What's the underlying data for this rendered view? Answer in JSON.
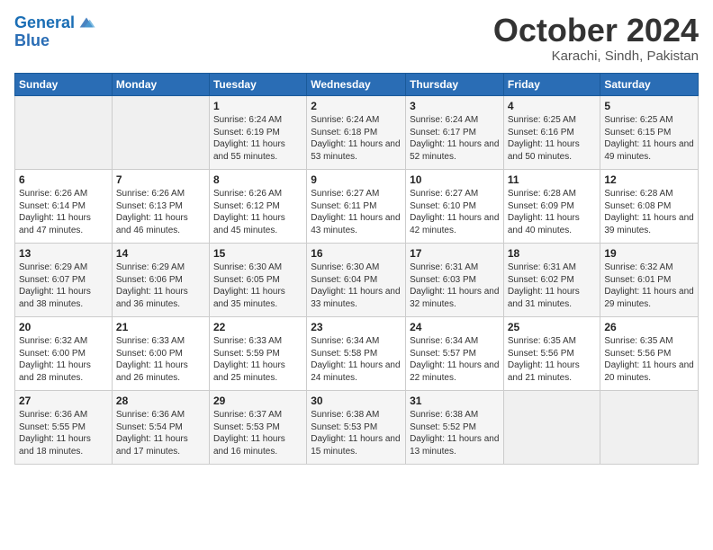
{
  "header": {
    "logo_line1": "General",
    "logo_line2": "Blue",
    "month": "October 2024",
    "location": "Karachi, Sindh, Pakistan"
  },
  "days_of_week": [
    "Sunday",
    "Monday",
    "Tuesday",
    "Wednesday",
    "Thursday",
    "Friday",
    "Saturday"
  ],
  "weeks": [
    [
      {
        "day": "",
        "info": ""
      },
      {
        "day": "",
        "info": ""
      },
      {
        "day": "1",
        "info": "Sunrise: 6:24 AM\nSunset: 6:19 PM\nDaylight: 11 hours and 55 minutes."
      },
      {
        "day": "2",
        "info": "Sunrise: 6:24 AM\nSunset: 6:18 PM\nDaylight: 11 hours and 53 minutes."
      },
      {
        "day": "3",
        "info": "Sunrise: 6:24 AM\nSunset: 6:17 PM\nDaylight: 11 hours and 52 minutes."
      },
      {
        "day": "4",
        "info": "Sunrise: 6:25 AM\nSunset: 6:16 PM\nDaylight: 11 hours and 50 minutes."
      },
      {
        "day": "5",
        "info": "Sunrise: 6:25 AM\nSunset: 6:15 PM\nDaylight: 11 hours and 49 minutes."
      }
    ],
    [
      {
        "day": "6",
        "info": "Sunrise: 6:26 AM\nSunset: 6:14 PM\nDaylight: 11 hours and 47 minutes."
      },
      {
        "day": "7",
        "info": "Sunrise: 6:26 AM\nSunset: 6:13 PM\nDaylight: 11 hours and 46 minutes."
      },
      {
        "day": "8",
        "info": "Sunrise: 6:26 AM\nSunset: 6:12 PM\nDaylight: 11 hours and 45 minutes."
      },
      {
        "day": "9",
        "info": "Sunrise: 6:27 AM\nSunset: 6:11 PM\nDaylight: 11 hours and 43 minutes."
      },
      {
        "day": "10",
        "info": "Sunrise: 6:27 AM\nSunset: 6:10 PM\nDaylight: 11 hours and 42 minutes."
      },
      {
        "day": "11",
        "info": "Sunrise: 6:28 AM\nSunset: 6:09 PM\nDaylight: 11 hours and 40 minutes."
      },
      {
        "day": "12",
        "info": "Sunrise: 6:28 AM\nSunset: 6:08 PM\nDaylight: 11 hours and 39 minutes."
      }
    ],
    [
      {
        "day": "13",
        "info": "Sunrise: 6:29 AM\nSunset: 6:07 PM\nDaylight: 11 hours and 38 minutes."
      },
      {
        "day": "14",
        "info": "Sunrise: 6:29 AM\nSunset: 6:06 PM\nDaylight: 11 hours and 36 minutes."
      },
      {
        "day": "15",
        "info": "Sunrise: 6:30 AM\nSunset: 6:05 PM\nDaylight: 11 hours and 35 minutes."
      },
      {
        "day": "16",
        "info": "Sunrise: 6:30 AM\nSunset: 6:04 PM\nDaylight: 11 hours and 33 minutes."
      },
      {
        "day": "17",
        "info": "Sunrise: 6:31 AM\nSunset: 6:03 PM\nDaylight: 11 hours and 32 minutes."
      },
      {
        "day": "18",
        "info": "Sunrise: 6:31 AM\nSunset: 6:02 PM\nDaylight: 11 hours and 31 minutes."
      },
      {
        "day": "19",
        "info": "Sunrise: 6:32 AM\nSunset: 6:01 PM\nDaylight: 11 hours and 29 minutes."
      }
    ],
    [
      {
        "day": "20",
        "info": "Sunrise: 6:32 AM\nSunset: 6:00 PM\nDaylight: 11 hours and 28 minutes."
      },
      {
        "day": "21",
        "info": "Sunrise: 6:33 AM\nSunset: 6:00 PM\nDaylight: 11 hours and 26 minutes."
      },
      {
        "day": "22",
        "info": "Sunrise: 6:33 AM\nSunset: 5:59 PM\nDaylight: 11 hours and 25 minutes."
      },
      {
        "day": "23",
        "info": "Sunrise: 6:34 AM\nSunset: 5:58 PM\nDaylight: 11 hours and 24 minutes."
      },
      {
        "day": "24",
        "info": "Sunrise: 6:34 AM\nSunset: 5:57 PM\nDaylight: 11 hours and 22 minutes."
      },
      {
        "day": "25",
        "info": "Sunrise: 6:35 AM\nSunset: 5:56 PM\nDaylight: 11 hours and 21 minutes."
      },
      {
        "day": "26",
        "info": "Sunrise: 6:35 AM\nSunset: 5:56 PM\nDaylight: 11 hours and 20 minutes."
      }
    ],
    [
      {
        "day": "27",
        "info": "Sunrise: 6:36 AM\nSunset: 5:55 PM\nDaylight: 11 hours and 18 minutes."
      },
      {
        "day": "28",
        "info": "Sunrise: 6:36 AM\nSunset: 5:54 PM\nDaylight: 11 hours and 17 minutes."
      },
      {
        "day": "29",
        "info": "Sunrise: 6:37 AM\nSunset: 5:53 PM\nDaylight: 11 hours and 16 minutes."
      },
      {
        "day": "30",
        "info": "Sunrise: 6:38 AM\nSunset: 5:53 PM\nDaylight: 11 hours and 15 minutes."
      },
      {
        "day": "31",
        "info": "Sunrise: 6:38 AM\nSunset: 5:52 PM\nDaylight: 11 hours and 13 minutes."
      },
      {
        "day": "",
        "info": ""
      },
      {
        "day": "",
        "info": ""
      }
    ]
  ]
}
